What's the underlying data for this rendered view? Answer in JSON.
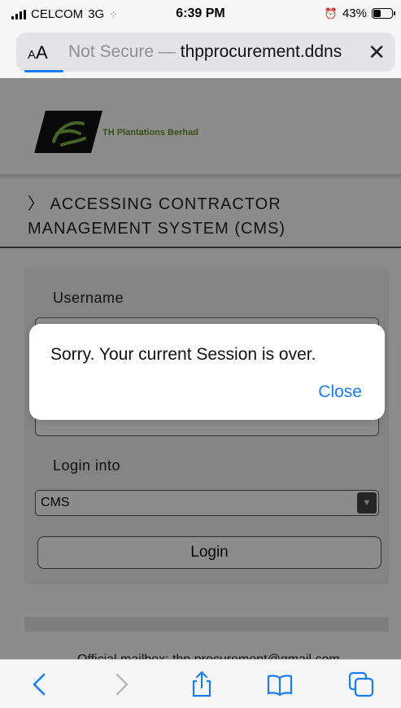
{
  "status_bar": {
    "carrier": "CELCOM",
    "network": "3G",
    "time": "6:39 PM",
    "battery_percent": "43%",
    "battery_level": 0.43
  },
  "url_bar": {
    "aa_small": "A",
    "aa_large": "A",
    "not_secure": "Not Secure —",
    "domain": "thpprocurement.ddns"
  },
  "header": {
    "company_name": "TH Plantations Berhad"
  },
  "section": {
    "title": "〉 ACCESSING CONTRACTOR MANAGEMENT SYSTEM (CMS)"
  },
  "form": {
    "username_label": "Username",
    "login_into_label": "Login into",
    "system_selected": "CMS",
    "login_button": "Login"
  },
  "footer": {
    "mailbox_text": "Official mailbox: thp.procurement@gmail.com"
  },
  "alert": {
    "message": "Sorry. Your current Session is over.",
    "close_label": "Close"
  },
  "toolbar": {
    "icons": [
      "back-icon",
      "forward-icon",
      "share-icon",
      "bookmarks-icon",
      "tabs-icon"
    ]
  },
  "colors": {
    "accent": "#1a7cf5",
    "logo_green": "#6b8e23"
  }
}
